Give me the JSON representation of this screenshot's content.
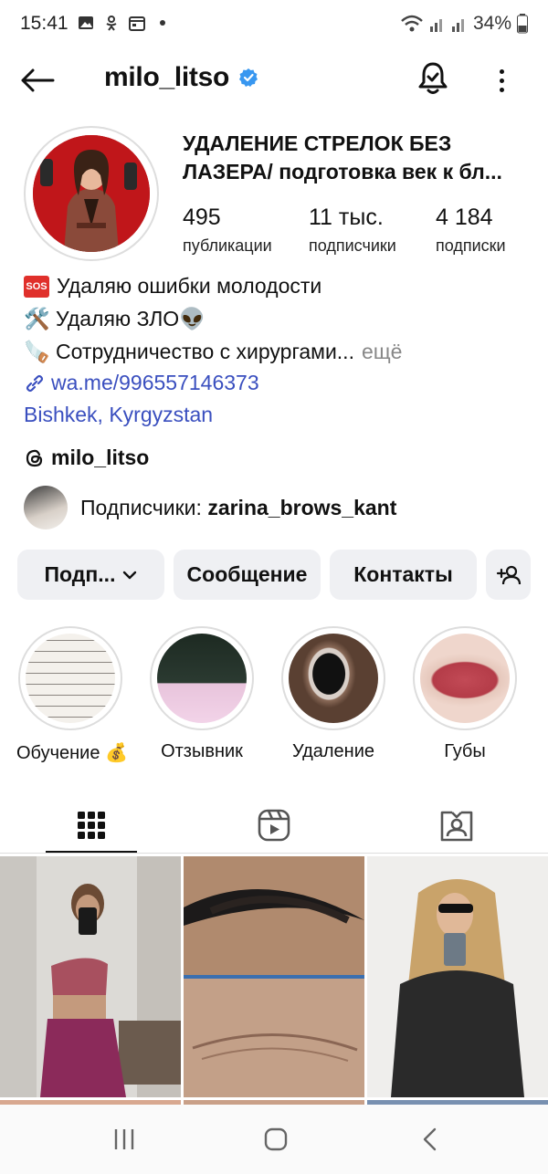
{
  "status_bar": {
    "time": "15:41",
    "battery": "34%",
    "icons": [
      "gallery-icon",
      "ok-icon",
      "calendar-icon",
      "dot-icon",
      "wifi-icon",
      "signal-icon",
      "signal-icon",
      "battery-icon"
    ]
  },
  "header": {
    "username": "milo_litso",
    "verified": true,
    "icons": [
      "back-arrow-icon",
      "bell-icon",
      "more-icon"
    ]
  },
  "profile": {
    "name_line1": "УДАЛЕНИЕ СТРЕЛОК БЕЗ",
    "name_line2": "ЛАЗЕРА/ подготовка век к бл...",
    "stats": [
      {
        "value": "495",
        "label": "публикации"
      },
      {
        "value": "11 тыс.",
        "label": "подписчики"
      },
      {
        "value": "4 184",
        "label": "подписки"
      }
    ]
  },
  "bio": {
    "line1": "Удаляю ошибки молодости",
    "line1_badge": "SOS",
    "line2": "🛠️ Удаляю ЗЛО👽",
    "line3": "🪚 Сотрудничество с хирургами...",
    "more": "ещё",
    "link": "wa.me/996557146373",
    "location": "Bishkek, Kyrgyzstan"
  },
  "threads": {
    "handle": "milo_litso"
  },
  "followers": {
    "prefix": "Подписчики:",
    "user": "zarina_brows_kant"
  },
  "buttons": {
    "follow": "Подп...",
    "message": "Сообщение",
    "contacts": "Контакты"
  },
  "highlights": [
    {
      "label": "Обучение 💰"
    },
    {
      "label": "Отзывник"
    },
    {
      "label": "Удаление"
    },
    {
      "label": "Губы"
    }
  ],
  "tabs": [
    "grid-icon",
    "reels-icon",
    "tagged-icon"
  ],
  "colors": {
    "verified": "#3897f0",
    "link": "#3a4fbf",
    "button_bg": "#eff0f3",
    "avatar_bg": "#c41a1a"
  }
}
